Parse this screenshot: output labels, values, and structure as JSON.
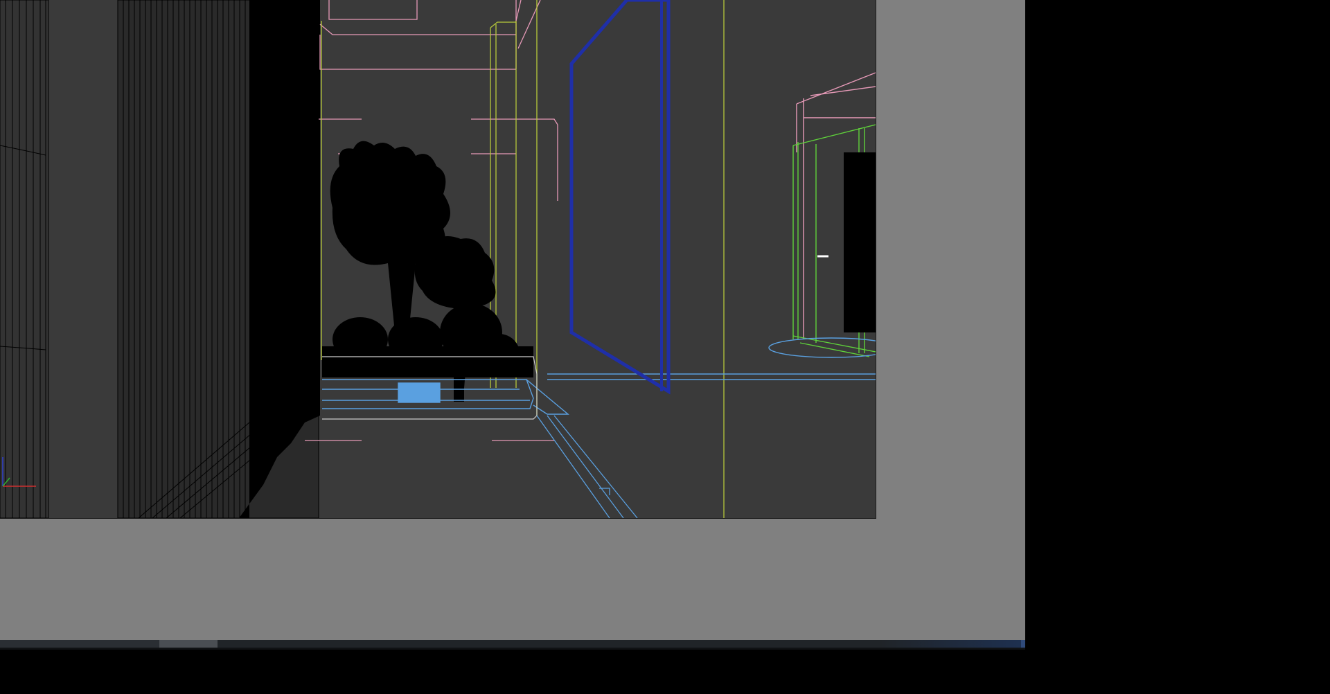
{
  "app": {
    "name": "",
    "viewport_label": ""
  },
  "viewport": {
    "background": "#3a3a3a",
    "display_mode": "wireframe-silhouette",
    "colors": {
      "wire_pink": "#e79ab8",
      "wire_yellow": "#b7c93a",
      "wire_green": "#5fd23a",
      "wire_blue_selected": "#1f2fa8",
      "wire_lightblue": "#5aa0e0",
      "silhouette": "#000000"
    }
  },
  "workspace": {
    "background": "#808080"
  },
  "status_bar": {
    "text": ""
  },
  "axis_gizmo": {
    "icon": "xyz-axis-icon"
  }
}
